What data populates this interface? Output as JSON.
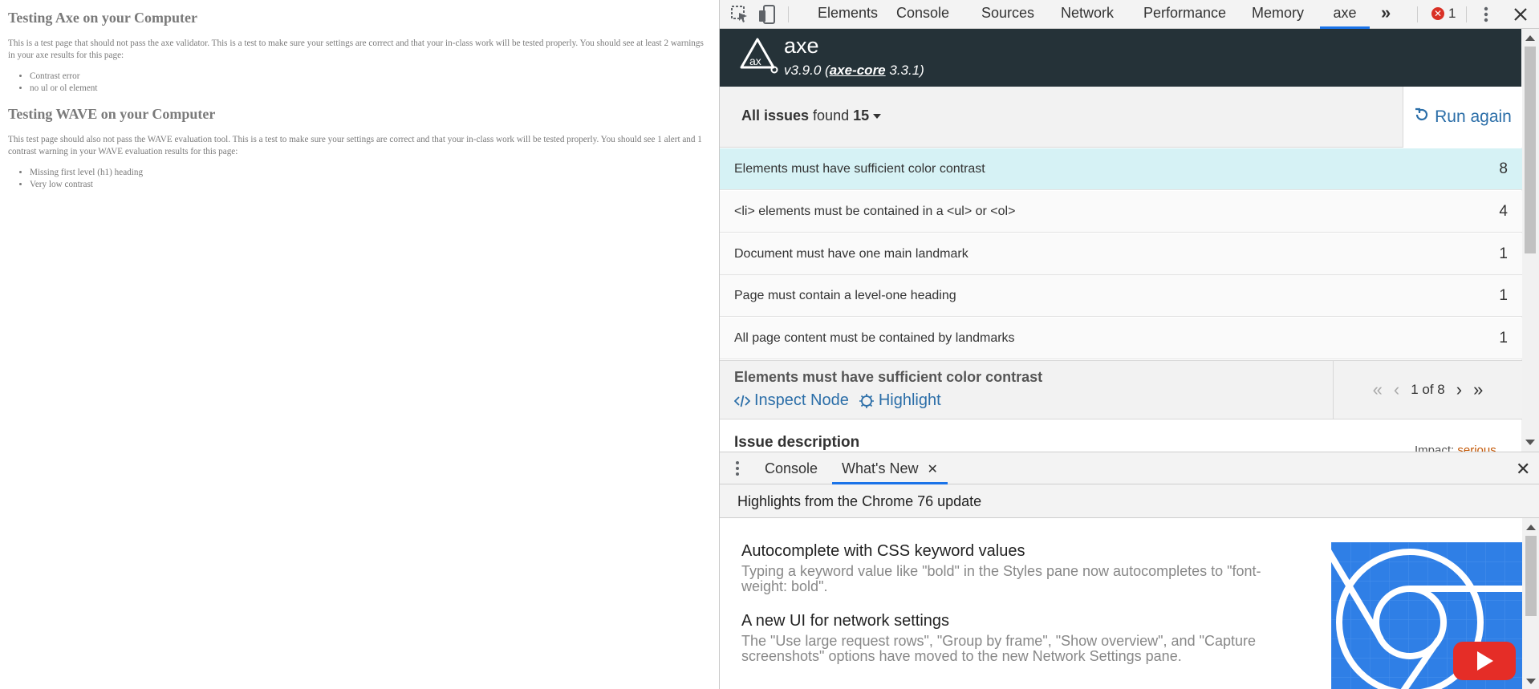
{
  "page": {
    "heading1": "Testing Axe on your Computer",
    "para1": "This is a test page that should not pass the axe validator. This is a test to make sure your settings are correct and that your in-class work will be tested properly. You should see at least 2 warnings in your axe results for this page:",
    "list1": [
      "Contrast error",
      "no ul or ol element"
    ],
    "heading2": "Testing WAVE on your Computer",
    "para2": "This test page should also not pass the WAVE evaluation tool. This is a test to make sure your settings are correct and that your in-class work will be tested properly. You should see 1 alert and 1 contrast warning in your WAVE evaluation results for this page:",
    "list2": [
      "Missing first level (h1) heading",
      "Very low contrast"
    ]
  },
  "devtools": {
    "tabs": [
      "Elements",
      "Console",
      "Sources",
      "Network",
      "Performance",
      "Memory",
      "axe"
    ],
    "active_tab": "axe",
    "more_tabs": "»",
    "error_count": "1",
    "close": "✕",
    "icons": [
      "inspect-element-icon",
      "device-toolbar-icon",
      "more-vertical-icon",
      "close-icon"
    ]
  },
  "axe": {
    "name": "axe",
    "version_prefix": "v3.9.0 (",
    "core_link": "axe-core",
    "core_version": " 3.3.1)",
    "issues_label": "All issues",
    "found_text": " found ",
    "issues_count": "15",
    "run_again": "Run again",
    "issues": [
      {
        "label": "Elements must have sufficient color contrast",
        "count": "8",
        "selected": true
      },
      {
        "label": "<li> elements must be contained in a <ul> or <ol>",
        "count": "4",
        "selected": false
      },
      {
        "label": "Document must have one main landmark",
        "count": "1",
        "selected": false
      },
      {
        "label": "Page must contain a level-one heading",
        "count": "1",
        "selected": false
      },
      {
        "label": "All page content must be contained by landmarks",
        "count": "1",
        "selected": false
      }
    ],
    "detail": {
      "title": "Elements must have sufficient color contrast",
      "inspect_node": "Inspect Node",
      "highlight": "Highlight",
      "pager": "1 of 8",
      "issue_description": "Issue description",
      "impact_label": "Impact: ",
      "impact_value": "serious"
    }
  },
  "drawer": {
    "tabs": [
      "Console",
      "What's New"
    ],
    "active_tab": "What's New",
    "highlights": "Highlights from the Chrome 76 update",
    "items": [
      {
        "title": "Autocomplete with CSS keyword values",
        "text": "Typing a keyword value like \"bold\" in the Styles pane now autocompletes to \"font-weight: bold\"."
      },
      {
        "title": "A new UI for network settings",
        "text": "The \"Use large request rows\", \"Group by frame\", \"Show overview\", and \"Capture screenshots\" options have moved to the new Network Settings pane."
      }
    ]
  },
  "colors": {
    "axe_header": "#253238",
    "accent_blue": "#1a73e8",
    "link_blue": "#2b6ea8",
    "selected_row": "#d6f2f5",
    "impact_serious": "#c25400"
  }
}
